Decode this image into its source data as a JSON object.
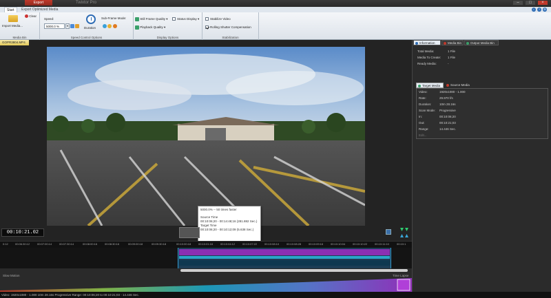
{
  "window": {
    "context_tab": "Export",
    "title": "Twixtor Pro"
  },
  "ribbon_tabs": {
    "start": "Start",
    "export": "Export Optimized Media"
  },
  "media_bin": {
    "import_label": "Import Media...",
    "clear_label": "Clear",
    "group_label": "Media Bin"
  },
  "speed_control": {
    "speed_label": "Speed:",
    "speed_value": "5000.0 %",
    "duration_label": "Duration",
    "subframe_label": "Sub-Frame Mode:",
    "group_label": "Speed Control Options"
  },
  "display_options": {
    "still_frame": "Still Frame Quality",
    "status_display": "Status Display",
    "playback_quality": "Playback Quality",
    "group_label": "Display Options"
  },
  "stabilization": {
    "stabilize": "Stabilize Video",
    "rolling_shutter": "Rolling Shutter Compensation",
    "stabilize_checked": false,
    "rolling_checked": true,
    "group_label": "Stabilization"
  },
  "file_tab": "GOPR3804.MP4",
  "tooltip": {
    "line1": "5000.0% -- 50 times faster",
    "source_label": "Source Time",
    "source_value": "00:10:06;20 - 00:14:48;16  (281.882 Sec.)",
    "target_label": "Target Time",
    "target_value": "00:10:06;20 - 00:10:12;09  (5.638 Sec.)"
  },
  "timecode": "00:10:21.02",
  "ruler_ticks": [
    "0:12",
    "00:06:30:12",
    "00:07:00:14",
    "00:07:30:14",
    "00:08:00:16",
    "00:08:30:16",
    "00:09:00:18",
    "00:09:30:18",
    "00:10:00:18",
    "00:10:01:16",
    "00:10:04:12",
    "00:10:07:22",
    "00:10:08:10",
    "00:10:08:28",
    "00:10:09:16",
    "00:10:10:04",
    "00:10:10:22",
    "00:10:11:10",
    "00:10:1"
  ],
  "speed_chart": {
    "left_label": "Slow Motion",
    "right_label": "Time Lapse"
  },
  "status_bar": "Video: 1920x1080 - 1.000   10m 28.16s  Progressive   Range: 00:10:06;20 to 00:10:21;03 - 14.446 Sec.",
  "right_panel": {
    "tabs": [
      "Information",
      "Media Bin",
      "Output Media Bin"
    ],
    "summary": [
      {
        "label": "Total Media:",
        "value": "1 File"
      },
      {
        "label": "Media To Create:",
        "value": "1 File"
      },
      {
        "label": "Ready Media:",
        "value": "-"
      }
    ],
    "subtabs": [
      "Target Media",
      "Source Media"
    ],
    "details": [
      {
        "label": "Video:",
        "value": "1920x1080 - 1.000"
      },
      {
        "label": "Rate:",
        "value": "29.970 f/s"
      },
      {
        "label": "Duration:",
        "value": "10m 28.16s"
      },
      {
        "label": "Scan Mode:",
        "value": "Progressive"
      },
      {
        "label": "In:",
        "value": "00:10:06;20"
      },
      {
        "label": "Out:",
        "value": "00:10:21;03"
      },
      {
        "label": "Range:",
        "value": "14.446 Sec."
      }
    ],
    "edit_link": "Edit..."
  },
  "colors": {
    "accent": "#2f6db5",
    "timeline_purple": "#8b2fb3",
    "timeline_cyan": "#2aa6c9",
    "file_tab": "#e2c95a"
  }
}
